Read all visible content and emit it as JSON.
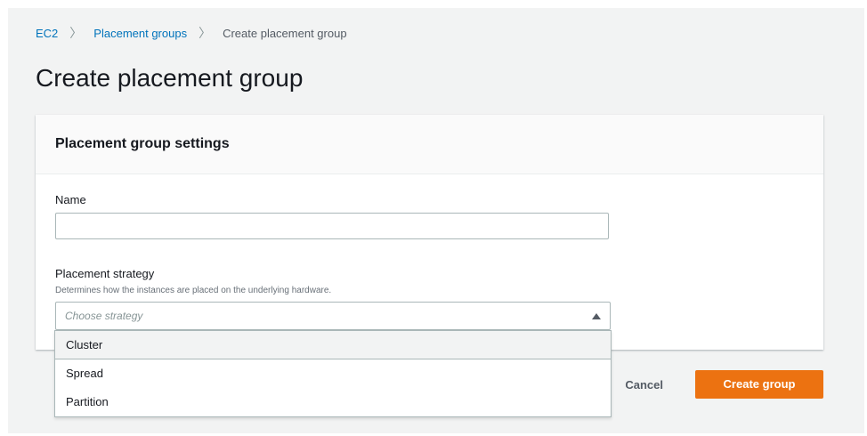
{
  "breadcrumb": {
    "items": [
      "EC2",
      "Placement groups",
      "Create placement group"
    ]
  },
  "page_title": "Create placement group",
  "panel": {
    "header": "Placement group settings",
    "name_label": "Name",
    "name_value": "",
    "strategy_label": "Placement strategy",
    "strategy_description": "Determines how the instances are placed on the underlying hardware.",
    "strategy_placeholder": "Choose strategy"
  },
  "dropdown": {
    "options": [
      "Cluster",
      "Spread",
      "Partition"
    ]
  },
  "actions": {
    "cancel_label": "Cancel",
    "create_label": "Create group"
  },
  "colors": {
    "accent": "#ec7211",
    "link": "#0073bb"
  }
}
